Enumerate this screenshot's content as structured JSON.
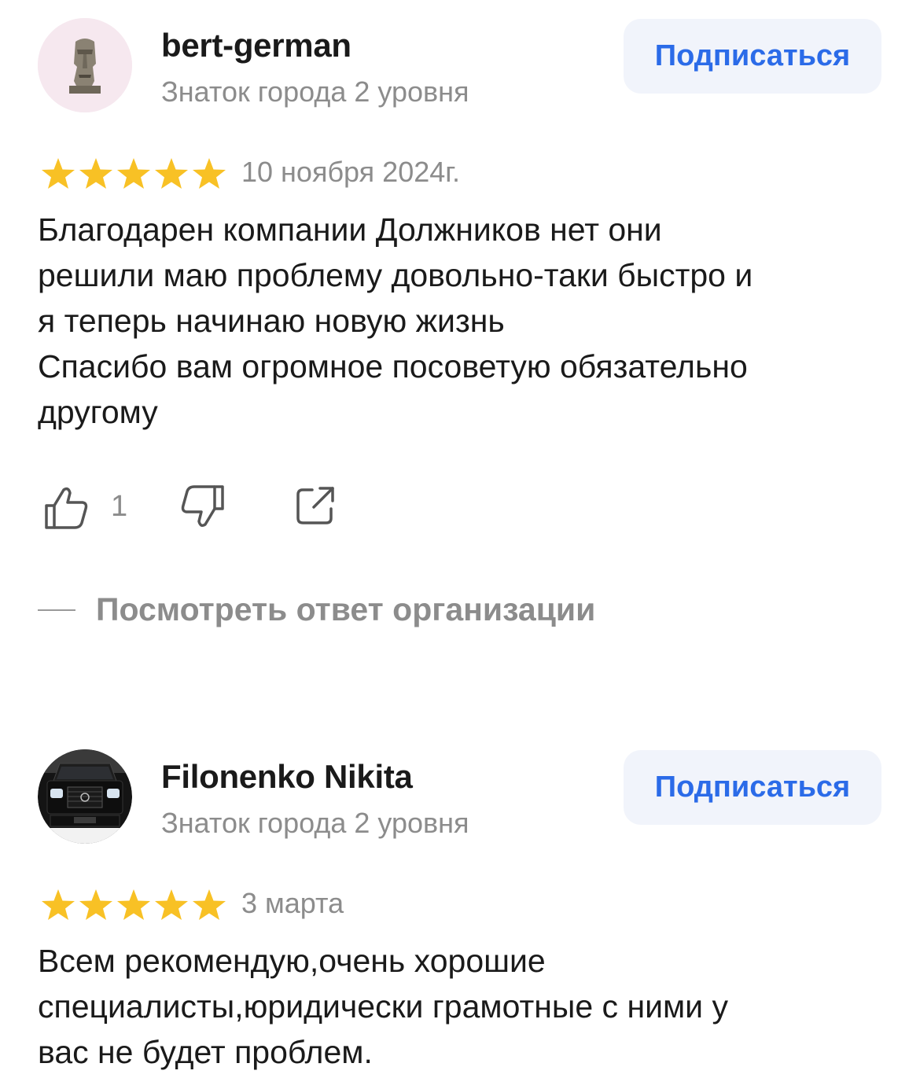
{
  "reviews": [
    {
      "author": "bert-german",
      "level": "Знаток города 2 уровня",
      "subscribe_label": "Подписаться",
      "rating": 5,
      "date": "10 ноября 2024г.",
      "text": "Благодарен компании Должников нет они\nрешили маю проблему довольно-таки быстро и\nя теперь начинаю новую жизнь\nСпасибо вам огромное посоветую обязательно\nдругому",
      "likes": "1",
      "org_reply_label": "Посмотреть ответ организации"
    },
    {
      "author": "Filonenko Nikita",
      "level": "Знаток города 2 уровня",
      "subscribe_label": "Подписаться",
      "rating": 5,
      "date": "3 марта",
      "text": "Всем рекомендую,очень хорошие\nспециалисты,юридически грамотные с ними у\nвас не будет проблем."
    }
  ],
  "colors": {
    "star": "#f8c125",
    "accent": "#2b6be8",
    "muted": "#8c8c8c",
    "button_bg": "#f1f4fb"
  }
}
